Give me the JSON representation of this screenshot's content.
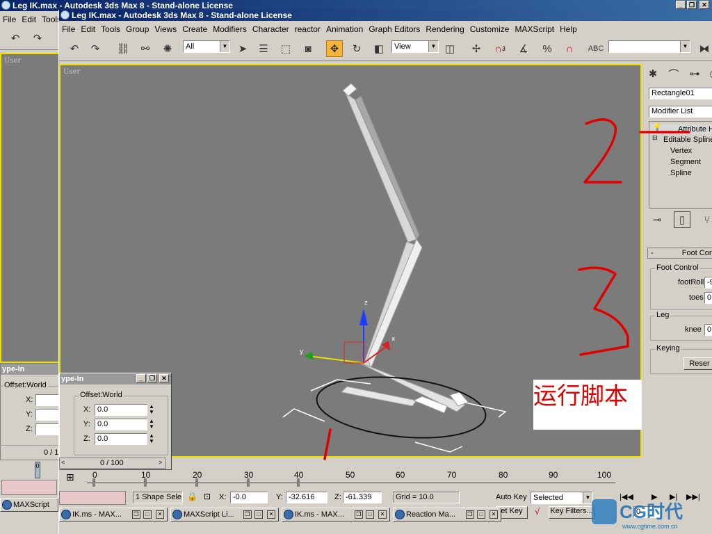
{
  "back_window": {
    "title": "Leg IK.max - Autodesk 3ds Max 8  - Stand-alone License",
    "menu": [
      "File",
      "Edit",
      "Tools"
    ],
    "viewport_label": "User",
    "typein_title": "ype-In",
    "offset_label": "Offset:World",
    "axes": [
      "X:",
      "Y:",
      "Z:"
    ],
    "time_slider": "0 / 1",
    "frame": "0",
    "taskbar_title": "MAXScript"
  },
  "main_window": {
    "title": "Leg IK.max - Autodesk 3ds Max 8  - Stand-alone License",
    "menu": [
      "File",
      "Edit",
      "Tools",
      "Group",
      "Views",
      "Create",
      "Modifiers",
      "Character",
      "reactor",
      "Animation",
      "Graph Editors",
      "Rendering",
      "Customize",
      "MAXScript",
      "Help"
    ],
    "toolbar": {
      "selection_filter": "All",
      "reference_coord": "View",
      "snap_label": "3",
      "named_selection": ""
    },
    "viewport_label": "User",
    "annotation_text": "运行脚本",
    "axis_labels": {
      "x": "x",
      "y": "y",
      "z": "z"
    }
  },
  "typein_dialog": {
    "title": "ype-In",
    "group": "Offset:World",
    "x_label": "X:",
    "x_value": "0.0",
    "y_label": "Y:",
    "y_value": "0.0",
    "z_label": "Z:",
    "z_value": "0.0"
  },
  "command_panel": {
    "object_name": "Rectangle01",
    "modifier_list": "Modifier List",
    "stack": [
      "Attribute H",
      "Editable Spline",
      "Vertex",
      "Segment",
      "Spline"
    ],
    "rollout_title": "Foot Con",
    "foot_group": "Foot Control",
    "footroll_label": "footRoll",
    "footroll_value": "-9",
    "toes_label": "toes",
    "toes_value": "0.",
    "leg_group": "Leg",
    "knee_label": "knee",
    "knee_value": "0.",
    "keying_group": "Keying",
    "reset_label": "Reser"
  },
  "timeline": {
    "slider_text": "0 / 100",
    "ticks": [
      "0",
      "10",
      "20",
      "30",
      "40",
      "50",
      "60",
      "70",
      "80",
      "90",
      "100"
    ]
  },
  "status_bar": {
    "selection": "1 Shape Sele",
    "x_label": "X:",
    "x_value": "-0.0",
    "y_label": "Y:",
    "y_value": "-32.616",
    "z_label": "Z:",
    "z_value": "-61.339",
    "grid": "Grid = 10.0",
    "auto_key": "Auto Key",
    "selected": "Selected",
    "set_key": "et Key",
    "key_filters": "Key Filters...",
    "frame": "0"
  },
  "taskbar": [
    {
      "label": "IK.ms - MAX..."
    },
    {
      "label": "MAXScript Li..."
    },
    {
      "label": "IK.ms - MAX..."
    },
    {
      "label": "Reaction Ma..."
    }
  ],
  "watermark": {
    "brand": "CG时代",
    "url": "www.cgtime.com.cn"
  },
  "colors": {
    "viewport_bg": "#7b7b7b",
    "viewport_border": "#f0e000",
    "ink": "#e00000",
    "title_gradient_start": "#0a246a",
    "active_tool": "#f5b53a"
  }
}
